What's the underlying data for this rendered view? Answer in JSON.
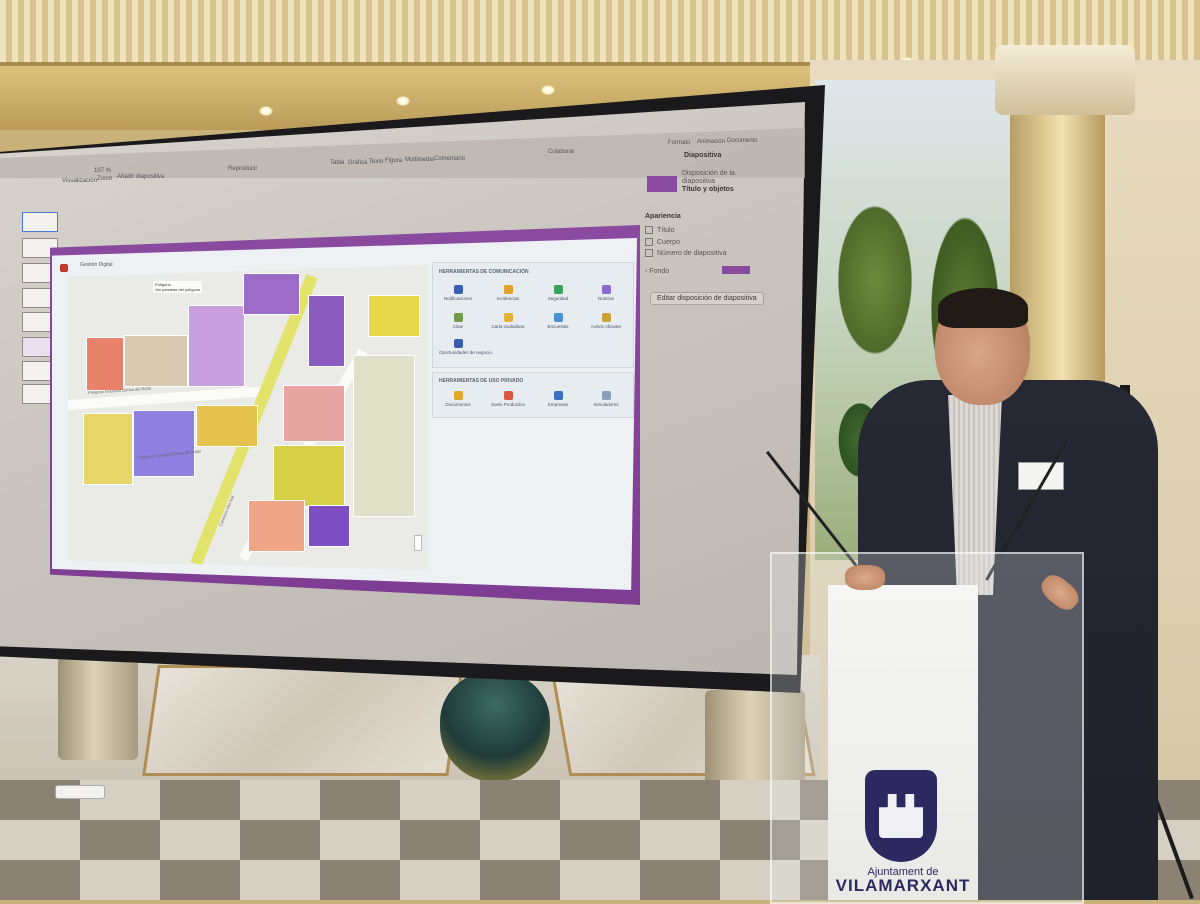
{
  "presentation_app": {
    "toolbar_left": [
      "Visualización",
      "Zoom",
      "Añadir diapositiva"
    ],
    "zoom_value": "107 %",
    "play_label": "Reproducir",
    "toolbar_center": [
      "Tabla",
      "Gráfica",
      "Texto",
      "Figura",
      "Multimedia",
      "Comentario"
    ],
    "collaborate_label": "Colaborar",
    "toolbar_right": [
      "Formato",
      "Animación",
      "Documento"
    ],
    "inspector": {
      "tab": "Diapositiva",
      "layout_label": "Disposición de la diapositiva",
      "layout_value": "Título y objetos",
      "appearance_heading": "Apariencia",
      "options": [
        "Título",
        "Cuerpo",
        "Número de diapositiva"
      ],
      "background_label": "Fondo",
      "edit_layout_button": "Editar disposición de diapositiva"
    }
  },
  "slide": {
    "app_title": "Gestión Digital",
    "map_caption_title": "Polígono",
    "map_caption_sub": "Ver parcelas del polígono",
    "street_labels": [
      "Polígono Industrial Ermita del Rafal",
      "Polígono Industrial Ermita del Rafal",
      "Carretera Vila-real"
    ],
    "panel_communication": {
      "heading": "HERRAMIENTAS DE COMUNICACIÓN",
      "tools": [
        "Notificaciones",
        "Incidencias",
        "Seguridad",
        "Noticias",
        "Citas",
        "Carta ciudadana",
        "Encuestas",
        "Avisos oficiales",
        "Oportunidades de negocio"
      ]
    },
    "panel_private": {
      "heading": "HERRAMIENTAS DE USO PRIVADO",
      "tools": [
        "Documentos",
        "Suelo Productivo",
        "Empresas",
        "Simuladores"
      ]
    }
  },
  "podium": {
    "line1": "Ajuntament de",
    "line2": "VILAMARXANT"
  }
}
